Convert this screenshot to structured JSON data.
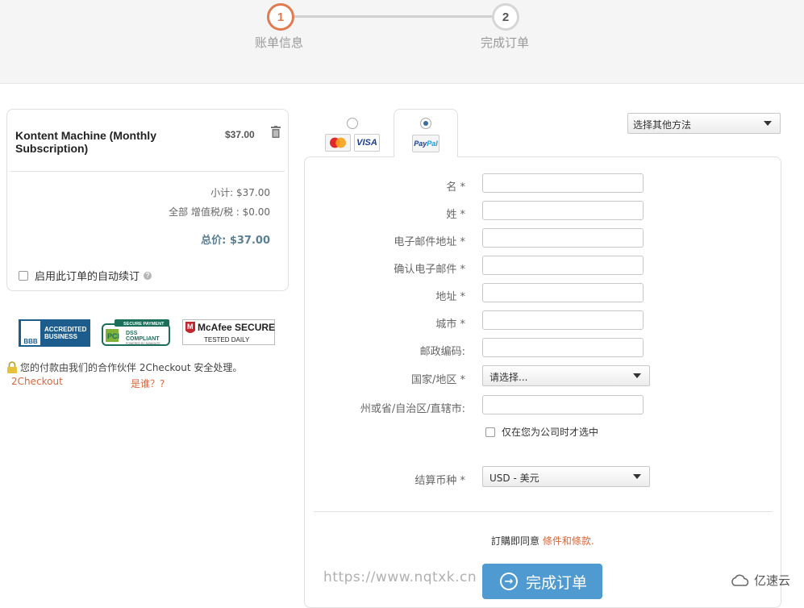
{
  "stepper": {
    "step1": {
      "number": "1",
      "label": "账单信息"
    },
    "step2": {
      "number": "2",
      "label": "完成订单"
    }
  },
  "order": {
    "item_name": "Kontent Machine (Monthly Subscription)",
    "item_price": "$37.00",
    "subtotal": "小计: $37.00",
    "tax": "全部 增值税/税 : $0.00",
    "total": "总价: $37.00",
    "auto_renew_label": "启用此订单的自动续订"
  },
  "badges": {
    "bbb_mark": "BBB",
    "bbb_text_line1": "ACCREDITED",
    "bbb_text_line2": "BUSINESS",
    "pci_top": "SECURE PAYMENT",
    "pci_main1": "DSS",
    "pci_main2": "COMPLIANT",
    "pci_bottom": "POWERED BY AVANGATE",
    "mcafee_main": "McAfee SECURE",
    "mcafee_sub": "TESTED DAILY"
  },
  "secure_note": {
    "text": "您的付款由我们的合作伙伴 2Checkout 安全处理。",
    "link": "2Checkout",
    "who": "是谁？?"
  },
  "payment": {
    "visa_label": "VISA",
    "paypal_prefix": "Pay",
    "paypal_suffix": "Pal",
    "other_method": "选择其他方法"
  },
  "form": {
    "first_name": "名 *",
    "last_name": "姓 *",
    "email": "电子邮件地址 *",
    "email_confirm": "确认电子邮件 *",
    "address": "地址 *",
    "city": "城市 *",
    "postal": "邮政编码:",
    "country": "国家/地区 *",
    "country_value": "请选择...",
    "state": "州或省/自治区/直辖市:",
    "company_only": "仅在您为公司时才选中",
    "currency": "结算币种 *",
    "currency_value": "USD - 美元",
    "agree_text": "訂購即同意",
    "agree_link": "條件和條款.",
    "submit": "完成订单"
  },
  "watermark": {
    "url": "https://www.nqtxk.cn",
    "brand": "亿速云"
  },
  "colors": {
    "accent": "#e07a4f",
    "link": "#d9673b",
    "button": "#4f9bd1",
    "total": "#5b7f93"
  }
}
